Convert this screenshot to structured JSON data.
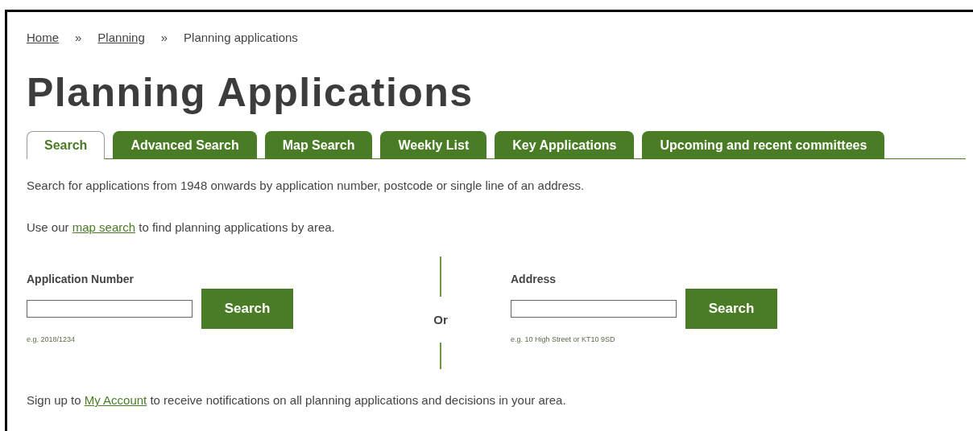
{
  "breadcrumb": [
    {
      "label": "Home",
      "link": true
    },
    {
      "label": "Planning",
      "link": true
    },
    {
      "label": "Planning applications",
      "link": false
    }
  ],
  "breadcrumb_separator": "»",
  "title": "Planning Applications",
  "tabs": [
    {
      "label": "Search",
      "selected": true
    },
    {
      "label": "Advanced Search",
      "selected": false
    },
    {
      "label": "Map Search",
      "selected": false
    },
    {
      "label": "Weekly List",
      "selected": false
    },
    {
      "label": "Key Applications",
      "selected": false
    },
    {
      "label": "Upcoming and recent committees",
      "selected": false
    }
  ],
  "intro": "Search for applications from 1948 onwards by application number, postcode or single line of an address.",
  "map_line": {
    "before": "Use our ",
    "link": "map search",
    "after": " to find planning applications by area."
  },
  "forms": [
    {
      "label": "Application Number",
      "button": "Search",
      "hint": "e.g. 2018/1234"
    },
    {
      "label": "Address",
      "button": "Search",
      "hint": "e.g. 10 High Street or KT10 9SD"
    }
  ],
  "or_label": "Or",
  "signup": {
    "before": "Sign up to ",
    "link": "My Account",
    "after": " to receive notifications on all planning applications and decisions in your area."
  }
}
